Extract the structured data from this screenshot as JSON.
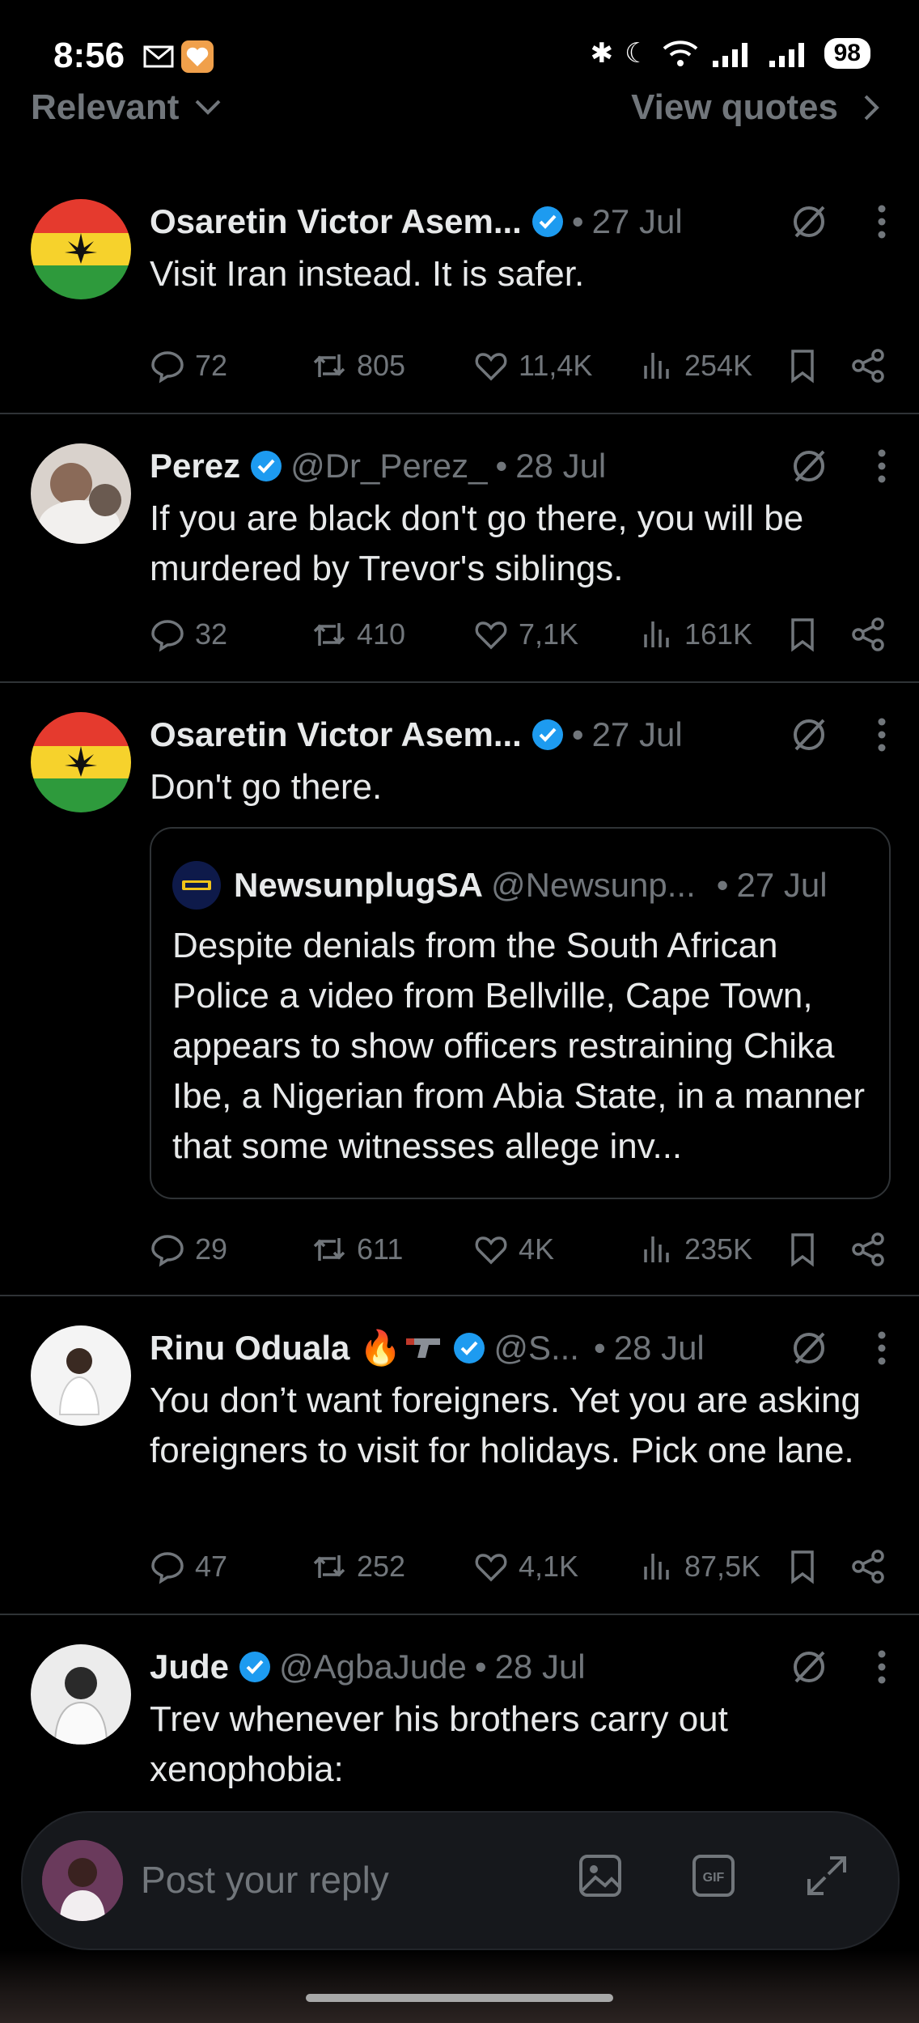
{
  "status": {
    "time": "8:56",
    "battery": "98"
  },
  "filter": {
    "sort_label": "Relevant",
    "view_quotes_label": "View quotes"
  },
  "tweets": [
    {
      "name": "Osaretin Victor Asem...",
      "handle": "",
      "separator": "•",
      "date": "27 Jul",
      "text": "Visit Iran instead. It is safer.",
      "replies": "72",
      "retweets": "805",
      "likes": "11,4K",
      "views": "254K"
    },
    {
      "name": "Perez",
      "handle": "@Dr_Perez_",
      "separator": "•",
      "date": "28 Jul",
      "text": "If you are black don't go there, you will be murdered by Trevor's siblings.",
      "replies": "32",
      "retweets": "410",
      "likes": "7,1K",
      "views": "161K"
    },
    {
      "name": "Osaretin Victor Asem...",
      "handle": "",
      "separator": "•",
      "date": "27 Jul",
      "text": "Don't go there.",
      "quote": {
        "name": "NewsunplugSA",
        "handle": "@Newsunp...",
        "separator": "•",
        "date": "27 Jul",
        "text": "Despite denials from the South African Police a video from Bellville, Cape Town, appears to show officers restraining Chika Ibe, a Nigerian from Abia State, in a manner that some witnesses allege inv..."
      },
      "replies": "29",
      "retweets": "611",
      "likes": "4K",
      "views": "235K"
    },
    {
      "name": "Rinu Oduala 🔥",
      "handle": "@S...",
      "separator": "•",
      "date": "28 Jul",
      "text": "You don’t want foreigners. Yet you are asking foreigners to visit for holidays. Pick one lane.",
      "replies": "47",
      "retweets": "252",
      "likes": "4,1K",
      "views": "87,5K"
    },
    {
      "name": "Jude",
      "handle": "@AgbaJude",
      "separator": "•",
      "date": "28 Jul",
      "text": "Trev whenever his brothers carry out xenophobia:"
    }
  ],
  "compose": {
    "placeholder": "Post your reply"
  },
  "colors": {
    "background": "#000000",
    "text": "#e7e9ea",
    "muted": "#71767b",
    "verified": "#1d9bf0",
    "divider": "#2f3336"
  }
}
